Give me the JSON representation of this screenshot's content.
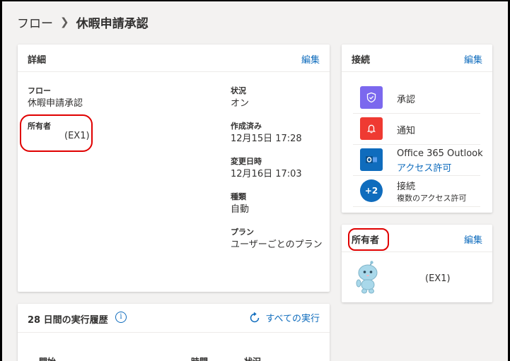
{
  "breadcrumb": {
    "root": "フロー",
    "current": "休暇申請承認"
  },
  "details": {
    "title": "詳細",
    "edit": "編集",
    "flow_label": "フロー",
    "flow_value": "休暇申請承認",
    "owner_label": "所有者",
    "owner_value": "(EX1)",
    "status_label": "状況",
    "status_value": "オン",
    "created_label": "作成済み",
    "created_value": "12月15日 17:28",
    "modified_label": "変更日時",
    "modified_value": "12月16日 17:03",
    "type_label": "種類",
    "type_value": "自動",
    "plan_label": "プラン",
    "plan_value": "ユーザーごとのプラン"
  },
  "connections": {
    "title": "接続",
    "edit": "編集",
    "items": [
      {
        "name": "承認",
        "icon": "approval-icon",
        "color": "#7b68ee"
      },
      {
        "name": "通知",
        "icon": "bell-icon",
        "color": "#ef3a32"
      },
      {
        "name": "Office 365 Outlook",
        "sub": "アクセス許可",
        "icon": "outlook-icon",
        "color": "#0f6cbd"
      },
      {
        "name": "接続",
        "sub": "複数のアクセス許可",
        "badge": "+2",
        "color": "#0f6cbd"
      }
    ]
  },
  "owners": {
    "title": "所有者",
    "edit": "編集",
    "owner_name": "(EX1)"
  },
  "history": {
    "title": "28 日間の実行履歴",
    "all_runs": "すべての実行",
    "col_start": "開始",
    "col_duration": "時間",
    "col_status": "状況"
  },
  "colors": {
    "accent": "#0f6cbd",
    "annotation": "#e00000"
  }
}
